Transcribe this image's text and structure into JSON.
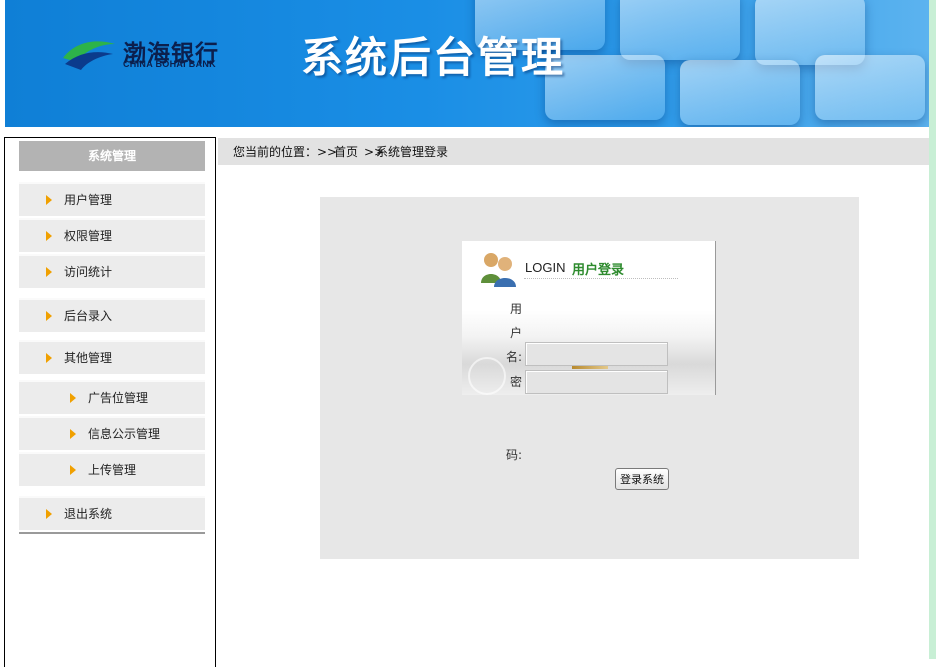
{
  "header": {
    "logo_cn": "渤海银行",
    "logo_en": "CHINA BOHAI BANK",
    "system_title": "系统后台管理"
  },
  "sidebar": {
    "title": "系统管理",
    "items": [
      {
        "label": "用户管理"
      },
      {
        "label": "权限管理"
      },
      {
        "label": "访问统计"
      },
      {
        "label": "后台录入"
      },
      {
        "label": "其他管理"
      },
      {
        "label": "广告位管理"
      },
      {
        "label": "信息公示管理"
      },
      {
        "label": "上传管理"
      },
      {
        "label": "退出系统"
      }
    ]
  },
  "breadcrumb": {
    "prefix": "您当前的位置：",
    "sep1": ">>",
    "home": "首页",
    "sep2": ">>",
    "current": "系统管理登录"
  },
  "login": {
    "login_word": "LOGIN",
    "title": "用户登录",
    "username_label_chars": [
      "用",
      "户",
      "名:"
    ],
    "username_value": "",
    "password_label_chars": [
      "密",
      "码:"
    ],
    "password_value": "",
    "submit_label": "登录系统"
  },
  "colors": {
    "header_blue": "#1a8ee5",
    "menu_bg": "#ececec",
    "menu_arrow": "#f0a000",
    "sidebar_title_bg": "#b3b3b3",
    "login_title_green": "#2e8b2e"
  },
  "icons": {
    "menu_arrow": "triangle-right-icon",
    "login_avatar": "users-icon",
    "logo": "bank-logo-icon"
  }
}
